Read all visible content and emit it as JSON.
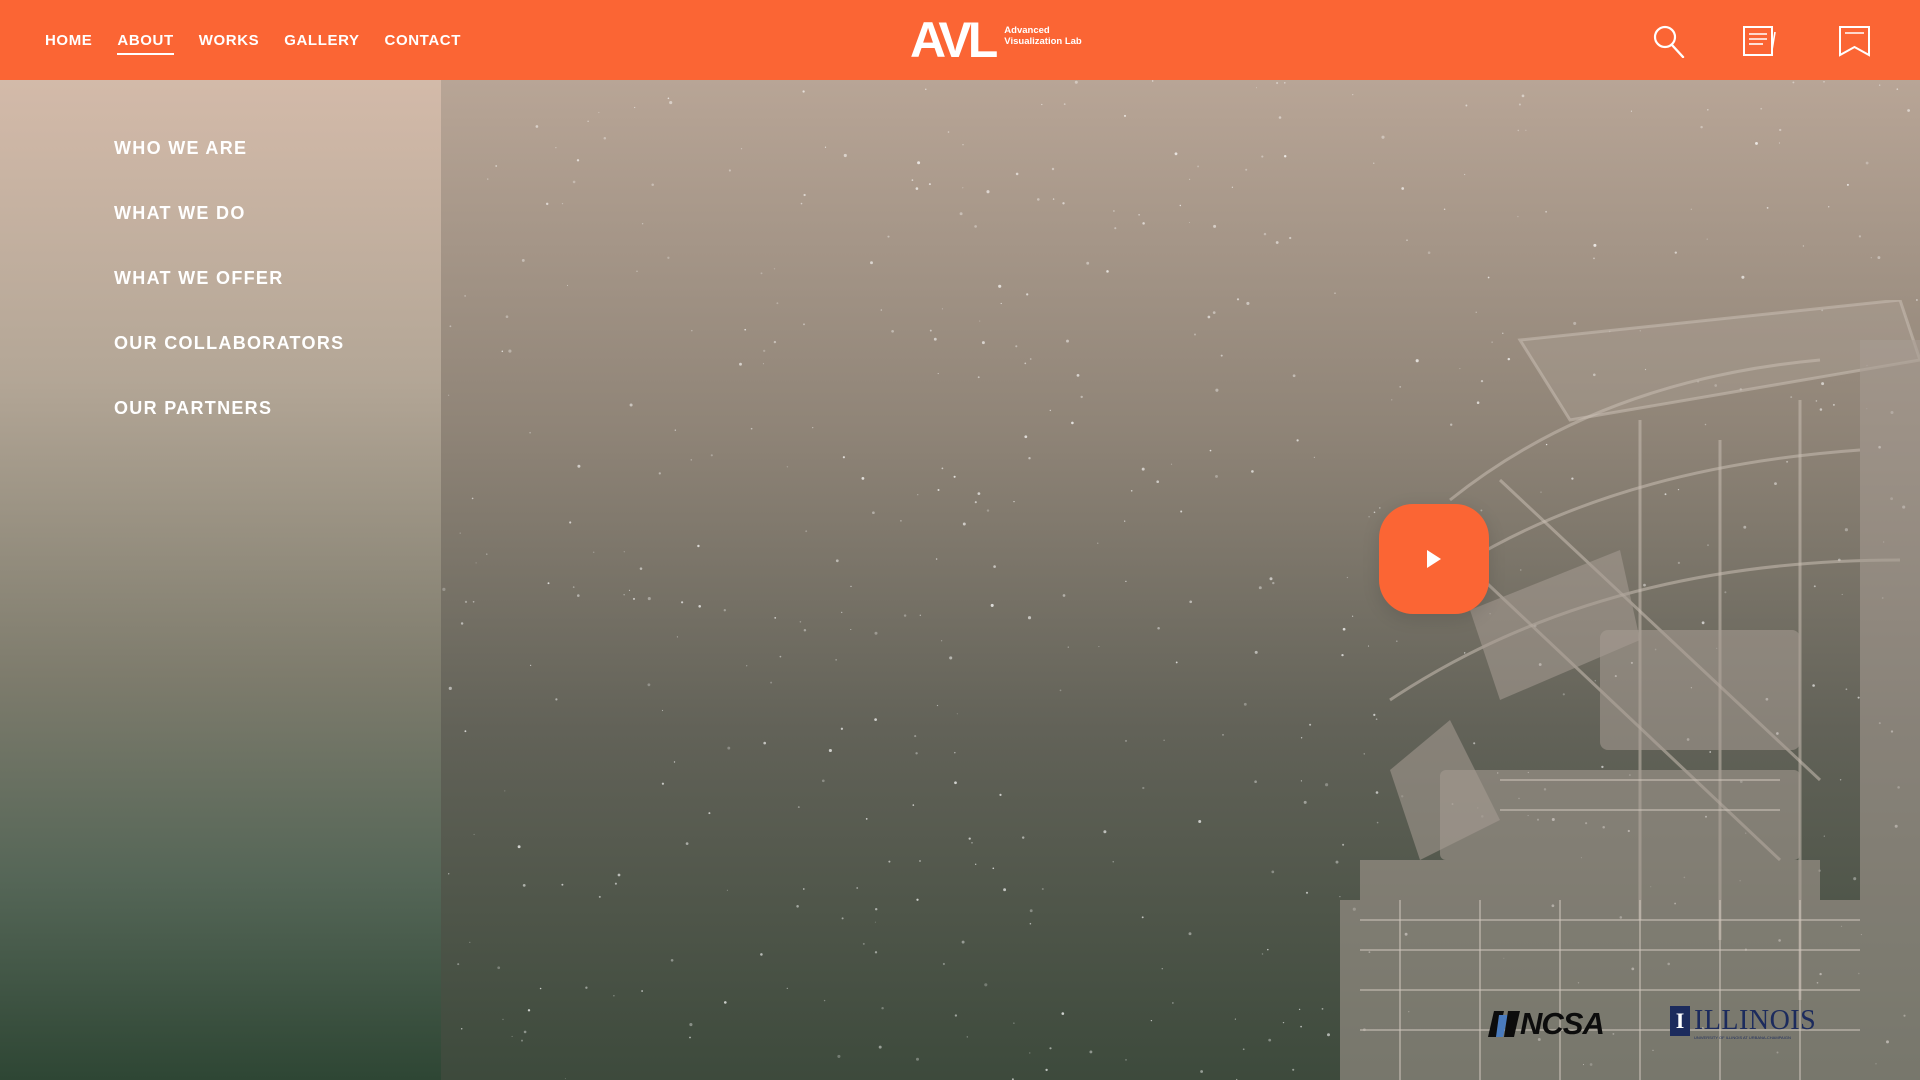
{
  "header": {
    "nav": [
      {
        "label": "HOME"
      },
      {
        "label": "ABOUT",
        "active": true
      },
      {
        "label": "WORKS"
      },
      {
        "label": "GALLERY"
      },
      {
        "label": "CONTACT"
      }
    ],
    "logo": {
      "mark": "AVL",
      "line1": "Advanced",
      "line2": "Visualization Lab"
    },
    "icons": [
      "search-icon",
      "notes-icon",
      "bookmark-icon"
    ]
  },
  "sidebar": {
    "items": [
      {
        "label": "WHO WE ARE"
      },
      {
        "label": "WHAT WE DO"
      },
      {
        "label": "WHAT WE OFFER"
      },
      {
        "label": "OUR COLLABORATORS"
      },
      {
        "label": "OUR PARTNERS"
      }
    ]
  },
  "hero": {
    "play_icon": "play-icon"
  },
  "partners": {
    "ncsa": "NCSA",
    "illinois": "ILLINOIS",
    "illinois_sub": "UNIVERSITY OF ILLINOIS AT URBANA-CHAMPAIGN"
  },
  "colors": {
    "brand_orange": "#fb6534",
    "white": "#ffffff",
    "illinois_blue": "#1c2b5d"
  }
}
